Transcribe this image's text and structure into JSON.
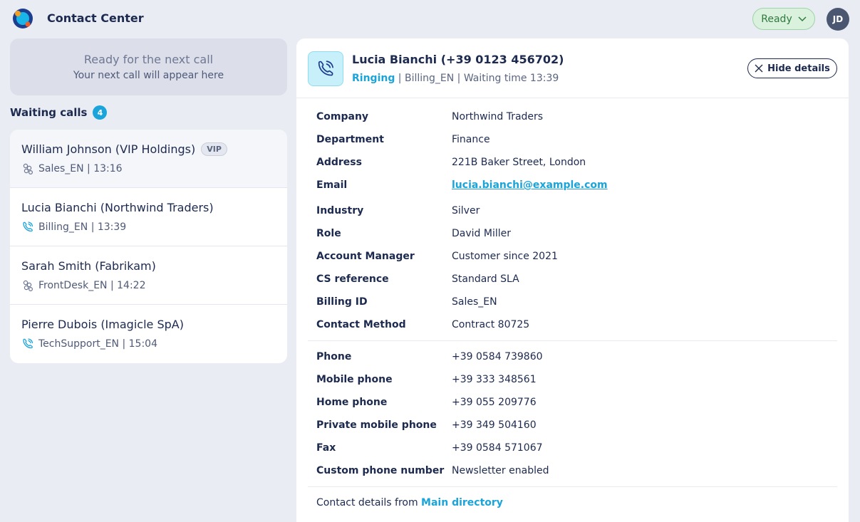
{
  "app": {
    "title": "Contact Center"
  },
  "status": {
    "label": "Ready"
  },
  "user": {
    "initials": "JD"
  },
  "ready_box": {
    "title": "Ready for the next call",
    "subtitle": "Your next call will appear here"
  },
  "waiting": {
    "title": "Waiting calls",
    "count": "4",
    "calls": [
      {
        "name": "William Johnson (VIP Holdings)",
        "badge": "VIP",
        "meta": "Sales_EN | 13:16",
        "icon": "group-icon"
      },
      {
        "name": "Lucia Bianchi (Northwind Traders)",
        "meta": "Billing_EN | 13:39",
        "icon": "phone-ringing-icon"
      },
      {
        "name": "Sarah Smith (Fabrikam)",
        "meta": "FrontDesk_EN | 14:22",
        "icon": "group-icon"
      },
      {
        "name": "Pierre Dubois (Imagicle SpA)",
        "meta": "TechSupport_EN | 15:04",
        "icon": "phone-ringing-icon"
      }
    ]
  },
  "details": {
    "caller_name": "Lucia Bianchi (+39 0123 456702)",
    "status_ringing": "Ringing",
    "status_rest": " | Billing_EN | Waiting time 13:39",
    "hide_label": "Hide details",
    "fields": [
      {
        "label": "Company",
        "value": "Northwind Traders"
      },
      {
        "label": "Department",
        "value": "Finance"
      },
      {
        "label": "Address",
        "value": "221B Baker Street, London"
      },
      {
        "label": "Email",
        "value": "lucia.bianchi@example.com"
      },
      {
        "label": "Industry",
        "value": "Silver"
      },
      {
        "label": "Role",
        "value": "David Miller"
      },
      {
        "label": "Account Manager",
        "value": "Customer since 2021"
      },
      {
        "label": "CS reference",
        "value": "Standard SLA"
      },
      {
        "label": "Billing ID",
        "value": "Sales_EN"
      },
      {
        "label": "Contact Method",
        "value": "Contract 80725"
      }
    ],
    "phones": [
      {
        "label": "Phone",
        "value": "+39 0584 739860"
      },
      {
        "label": "Mobile phone",
        "value": "+39 333 348561"
      },
      {
        "label": "Home phone",
        "value": "+39 055 209776"
      },
      {
        "label": "Private mobile phone",
        "value": "+39 349 504160"
      },
      {
        "label": "Fax",
        "value": "+39 0584 571067"
      },
      {
        "label": "Custom phone number",
        "value": "Newsletter enabled"
      }
    ],
    "footer_prefix": "Contact details from ",
    "footer_link": "Main directory"
  },
  "colors": {
    "accent": "#1aa4d9",
    "ready_green": "#d9f1dd",
    "text_dark": "#1d2a4f",
    "background": "#eaecf4"
  }
}
